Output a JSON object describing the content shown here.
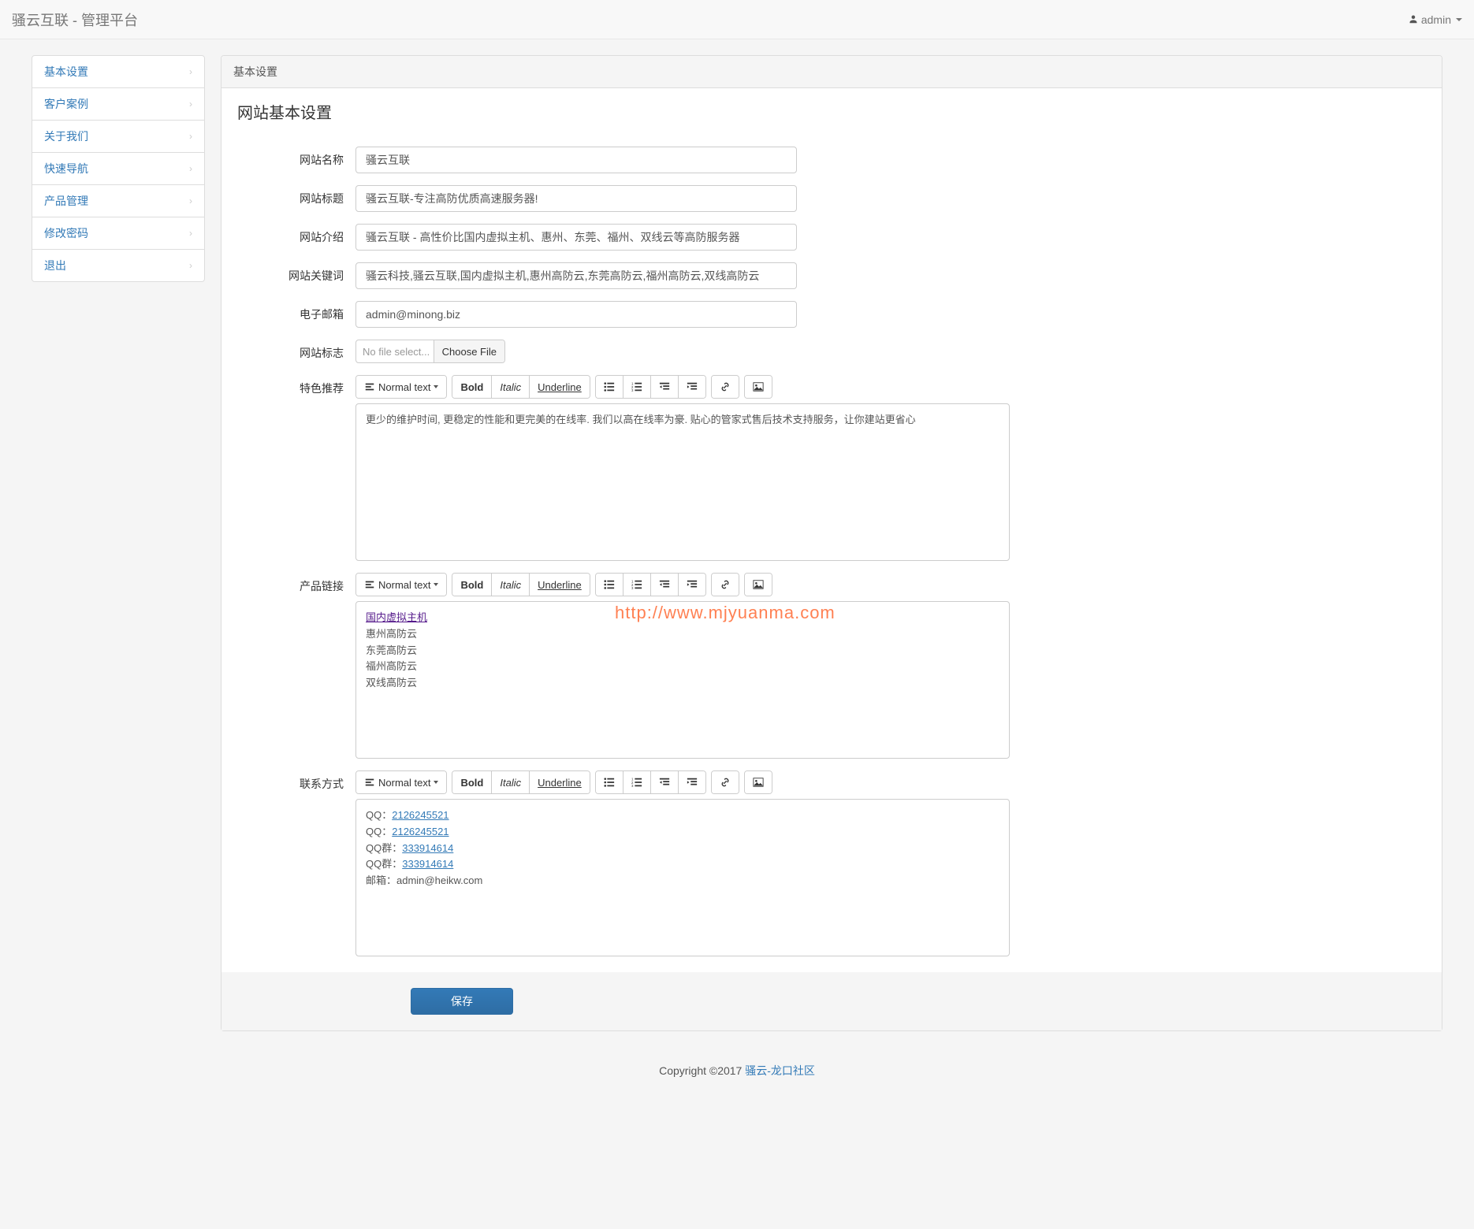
{
  "navbar": {
    "brand": "骚云互联 - 管理平台",
    "user": "admin"
  },
  "sidebar": {
    "items": [
      {
        "label": "基本设置"
      },
      {
        "label": "客户案例"
      },
      {
        "label": "关于我们"
      },
      {
        "label": "快速导航"
      },
      {
        "label": "产品管理"
      },
      {
        "label": "修改密码"
      },
      {
        "label": "退出"
      }
    ]
  },
  "panel": {
    "breadcrumb": "基本设置",
    "title": "网站基本设置"
  },
  "form": {
    "site_name_label": "网站名称",
    "site_name_value": "骚云互联",
    "site_title_label": "网站标题",
    "site_title_value": "骚云互联-专注高防优质高速服务器!",
    "site_desc_label": "网站介绍",
    "site_desc_value": "骚云互联 - 高性价比国内虚拟主机、惠州、东莞、福州、双线云等高防服务器",
    "site_keywords_label": "网站关键词",
    "site_keywords_value": "骚云科技,骚云互联,国内虚拟主机,惠州高防云,东莞高防云,福州高防云,双线高防云",
    "email_label": "电子邮箱",
    "email_value": "admin@minong.biz",
    "logo_label": "网站标志",
    "file_placeholder": "No file select...",
    "file_button": "Choose File",
    "featured_label": "特色推荐",
    "featured_content": "更少的维护时间, 更稳定的性能和更完美的在线率. 我们以高在线率为豪. 贴心的管家式售后技术支持服务，让你建站更省心",
    "products_label": "产品链接",
    "products_link": "国内虚拟主机",
    "products_lines": [
      "惠州高防云",
      "东莞高防云",
      "福州高防云",
      "双线高防云"
    ],
    "contact_label": "联系方式",
    "contact_qq1_label": "QQ：",
    "contact_qq1_value": "2126245521",
    "contact_qq2_label": "QQ：",
    "contact_qq2_value": "2126245521",
    "contact_qqgroup1_label": "QQ群：",
    "contact_qqgroup1_value": "333914614",
    "contact_qqgroup2_label": "QQ群：",
    "contact_qqgroup2_value": "333914614",
    "contact_email": "邮箱：admin@heikw.com",
    "submit": "保存"
  },
  "editor": {
    "normal_text": "Normal text",
    "bold": "Bold",
    "italic": "Italic",
    "underline": "Underline"
  },
  "footer": {
    "copyright": "Copyright ©2017 ",
    "link": "骚云-龙口社区"
  },
  "watermark": "http://www.mjyuanma.com"
}
